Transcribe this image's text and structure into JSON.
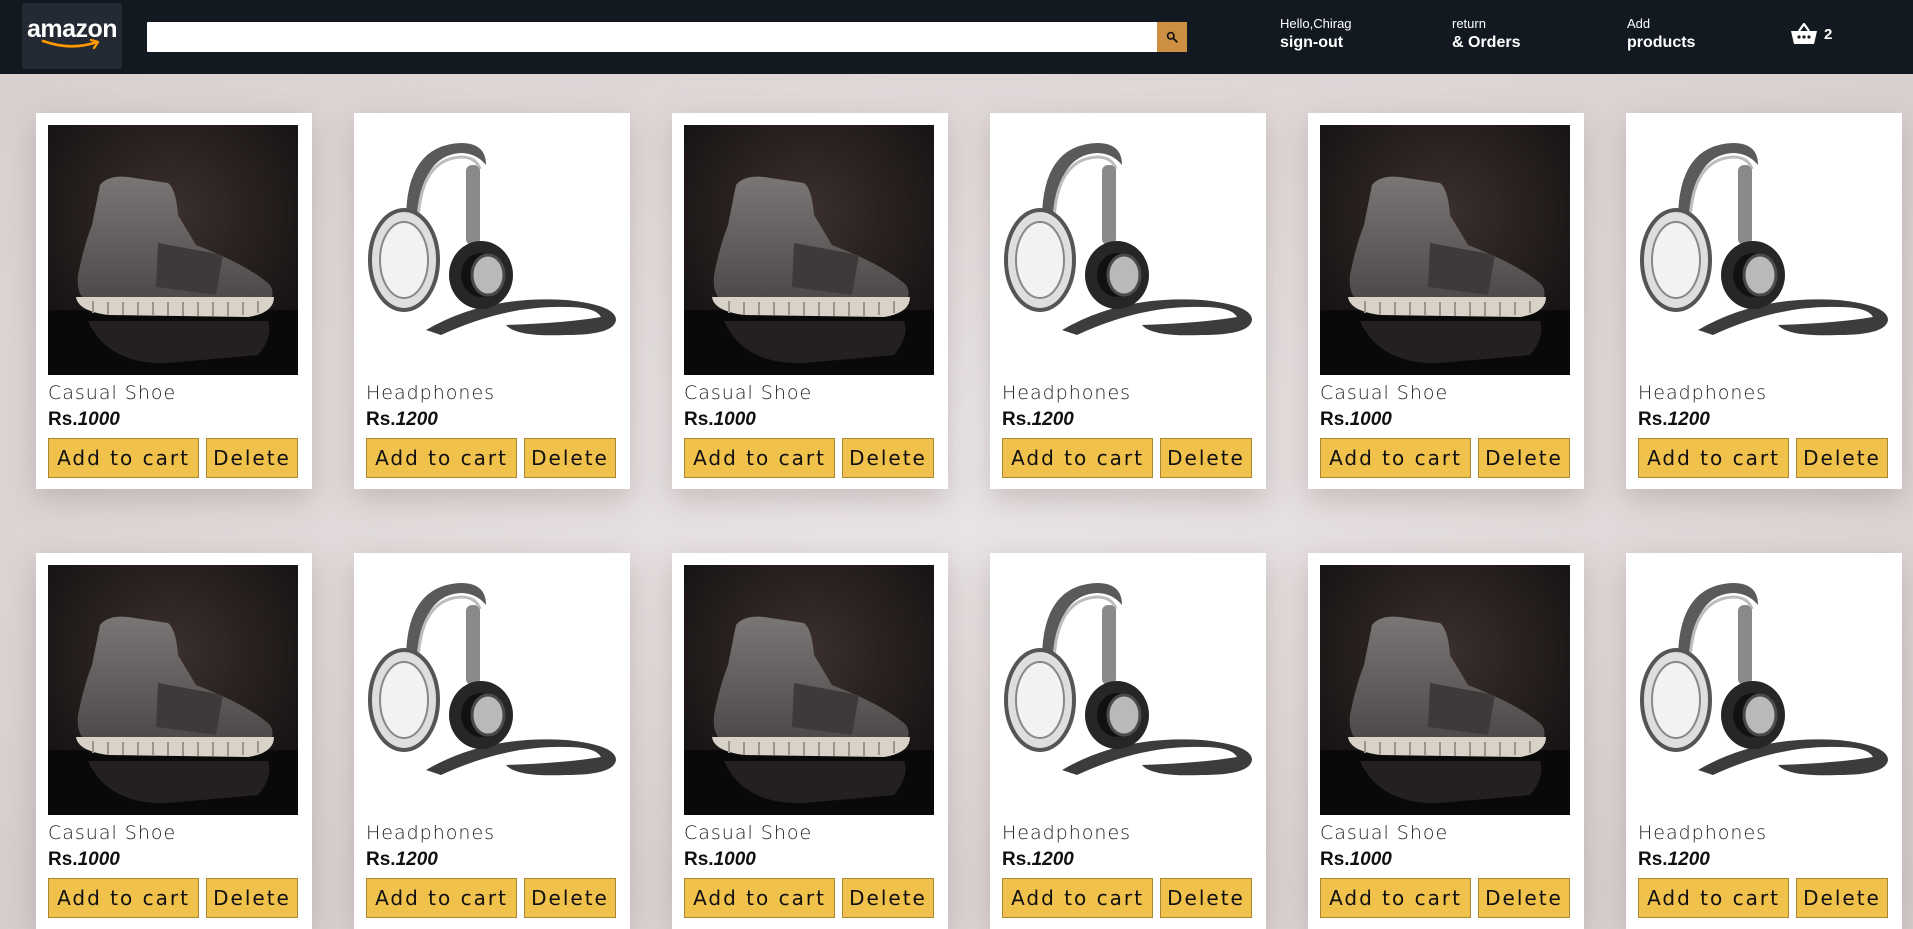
{
  "header": {
    "logo_text": "amazon",
    "search": {
      "value": "",
      "placeholder": ""
    },
    "nav": {
      "signout": {
        "line1": "Hello,Chirag",
        "line2": "sign-out"
      },
      "orders": {
        "line1": "return",
        "line2": "& Orders"
      },
      "add": {
        "line1": "Add",
        "line2": "products"
      }
    },
    "basket_count": "2"
  },
  "colors": {
    "header_bg": "#131921",
    "search_button": "#cd9042",
    "button_bg": "#f0c14b",
    "page_bg": "#ded6d6"
  },
  "products": [
    {
      "image": "shoe-image",
      "title": "Casual Shoe",
      "price_prefix": "Rs.",
      "price": "1000",
      "add_label": "Add to cart",
      "delete_label": "Delete"
    },
    {
      "image": "headphones-image",
      "title": "Headphones",
      "price_prefix": "Rs.",
      "price": "1200",
      "add_label": "Add to cart",
      "delete_label": "Delete"
    },
    {
      "image": "shoe-image",
      "title": "Casual Shoe",
      "price_prefix": "Rs.",
      "price": "1000",
      "add_label": "Add to cart",
      "delete_label": "Delete"
    },
    {
      "image": "headphones-image",
      "title": "Headphones",
      "price_prefix": "Rs.",
      "price": "1200",
      "add_label": "Add to cart",
      "delete_label": "Delete"
    },
    {
      "image": "shoe-image",
      "title": "Casual Shoe",
      "price_prefix": "Rs.",
      "price": "1000",
      "add_label": "Add to cart",
      "delete_label": "Delete"
    },
    {
      "image": "headphones-image",
      "title": "Headphones",
      "price_prefix": "Rs.",
      "price": "1200",
      "add_label": "Add to cart",
      "delete_label": "Delete"
    },
    {
      "image": "shoe-image",
      "title": "Casual Shoe",
      "price_prefix": "Rs.",
      "price": "1000",
      "add_label": "Add to cart",
      "delete_label": "Delete"
    },
    {
      "image": "headphones-image",
      "title": "Headphones",
      "price_prefix": "Rs.",
      "price": "1200",
      "add_label": "Add to cart",
      "delete_label": "Delete"
    },
    {
      "image": "shoe-image",
      "title": "Casual Shoe",
      "price_prefix": "Rs.",
      "price": "1000",
      "add_label": "Add to cart",
      "delete_label": "Delete"
    },
    {
      "image": "headphones-image",
      "title": "Headphones",
      "price_prefix": "Rs.",
      "price": "1200",
      "add_label": "Add to cart",
      "delete_label": "Delete"
    },
    {
      "image": "shoe-image",
      "title": "Casual Shoe",
      "price_prefix": "Rs.",
      "price": "1000",
      "add_label": "Add to cart",
      "delete_label": "Delete"
    },
    {
      "image": "headphones-image",
      "title": "Headphones",
      "price_prefix": "Rs.",
      "price": "1200",
      "add_label": "Add to cart",
      "delete_label": "Delete"
    }
  ]
}
